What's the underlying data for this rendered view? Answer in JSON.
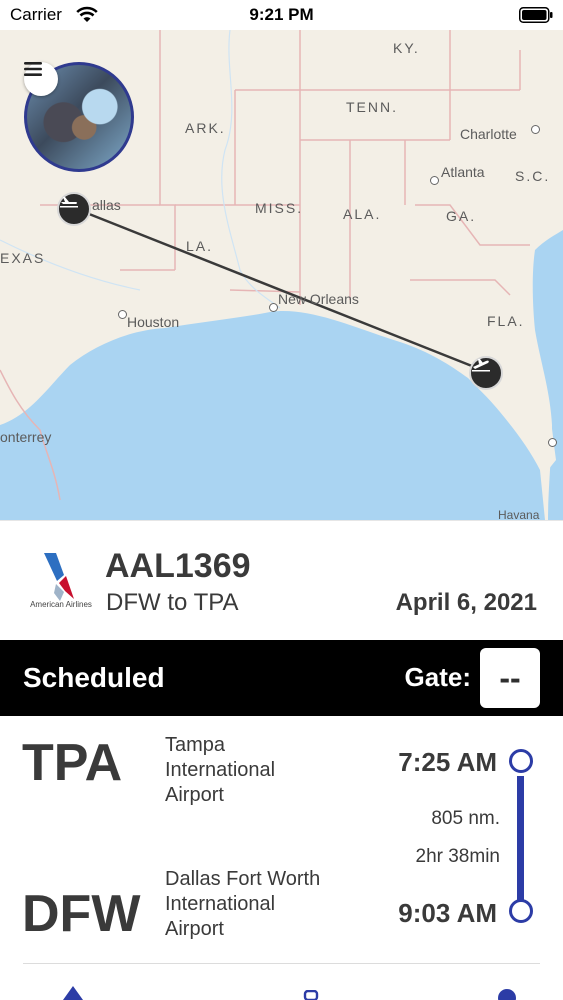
{
  "status_bar": {
    "carrier": "Carrier",
    "time": "9:21 PM"
  },
  "map": {
    "state_labels": {
      "ky": "KY.",
      "tenn": "TENN.",
      "ark": "ARK.",
      "sc": "S.C.",
      "miss": "MISS.",
      "ala": "ALA.",
      "ga": "GA.",
      "la": "LA.",
      "texas": "EXAS",
      "fla": "FLA."
    },
    "cities": {
      "charlotte": "Charlotte",
      "atlanta": "Atlanta",
      "dallas": "allas",
      "houston": "Houston",
      "new_orleans": "New Orleans",
      "monterrey": "onterrey",
      "havana": "Havana"
    },
    "colors": {
      "water": "#aad4f2",
      "land": "#f3efe6",
      "route": "#3a3a3a",
      "border": "#e8b4b4"
    }
  },
  "flight": {
    "airline": "American Airlines",
    "number": "AAL1369",
    "route": "DFW to TPA",
    "date": "April 6, 2021"
  },
  "status": {
    "text": "Scheduled",
    "gate_label": "Gate:",
    "gate_value": "--"
  },
  "arrival": {
    "code": "TPA",
    "name_line1": "Tampa",
    "name_line2": "International",
    "name_line3": "Airport",
    "time": "7:25 AM"
  },
  "departure": {
    "code": "DFW",
    "name_line1": "Dallas Fort Worth",
    "name_line2": "International",
    "name_line3": "Airport",
    "time": "9:03 AM"
  },
  "trip": {
    "distance": "805 nm.",
    "duration": "2hr 38min"
  },
  "accent_color": "#2c3ca6"
}
